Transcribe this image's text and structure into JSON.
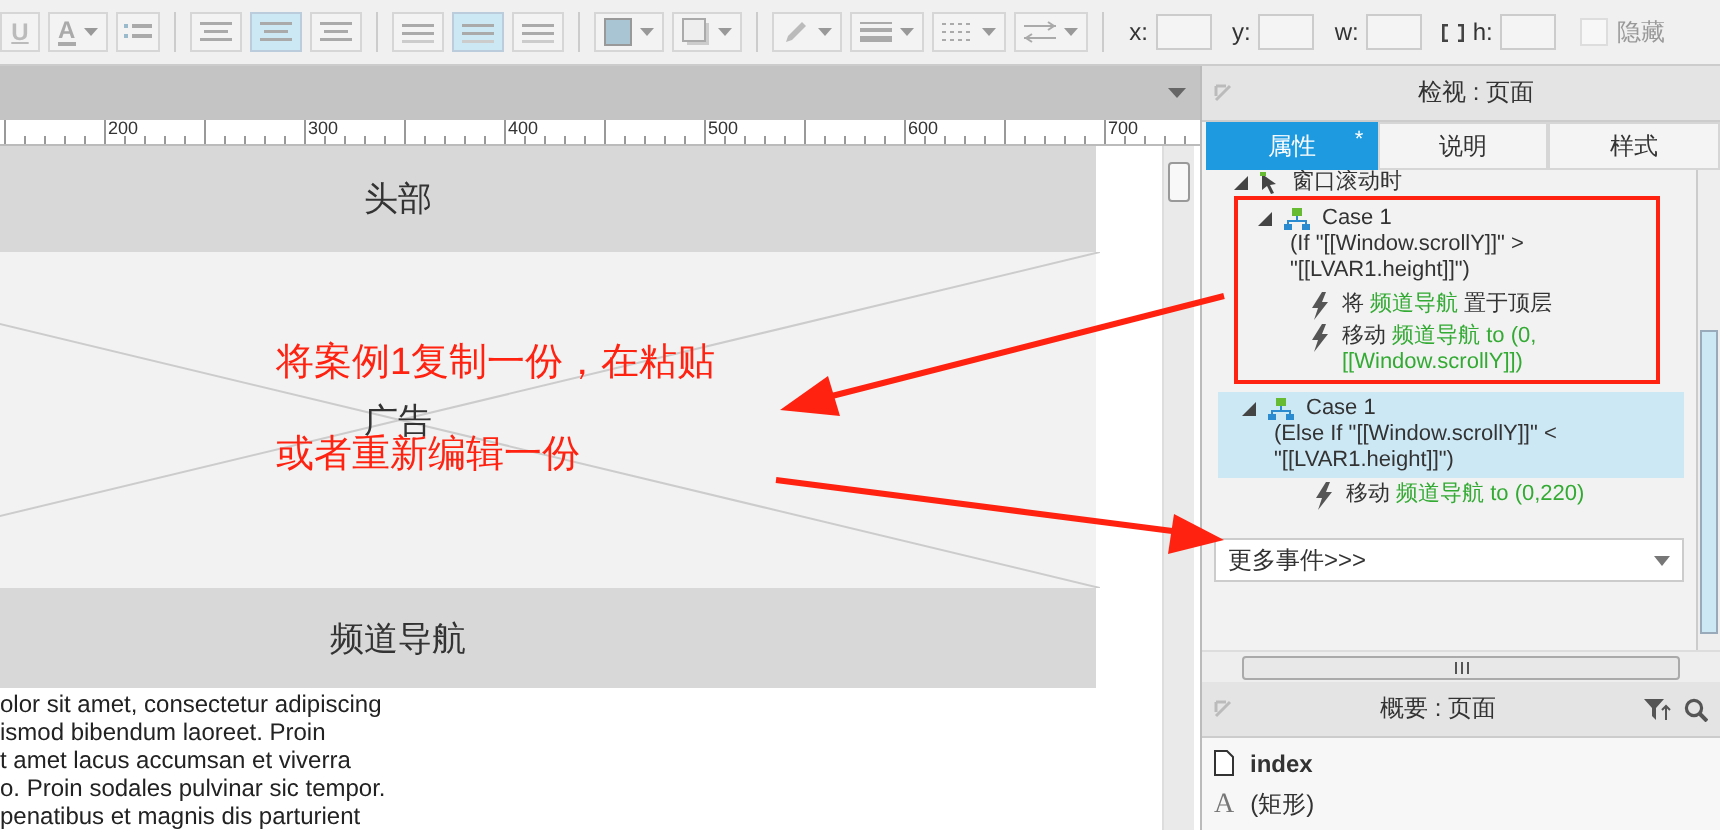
{
  "toolbar": {
    "tools": [
      {
        "kind": "text",
        "label": "U"
      },
      {
        "kind": "font-color",
        "label": "A",
        "dropdown": true
      },
      {
        "kind": "bullets"
      },
      {
        "kind": "separator"
      },
      {
        "kind": "align",
        "selected": false
      },
      {
        "kind": "align",
        "selected": true
      },
      {
        "kind": "align",
        "selected": false
      },
      {
        "kind": "separator"
      },
      {
        "kind": "valign",
        "selected": false
      },
      {
        "kind": "valign",
        "selected": true
      },
      {
        "kind": "valign",
        "selected": false
      },
      {
        "kind": "separator"
      },
      {
        "kind": "fill",
        "dropdown": true
      },
      {
        "kind": "shadow",
        "dropdown": true
      },
      {
        "kind": "separator"
      },
      {
        "kind": "pen",
        "dropdown": true
      },
      {
        "kind": "line-width",
        "dropdown": true
      },
      {
        "kind": "line-style",
        "dropdown": true
      },
      {
        "kind": "arrow-style",
        "dropdown": true
      },
      {
        "kind": "separator"
      }
    ],
    "fields": [
      {
        "label": "x:"
      },
      {
        "label": "y:"
      },
      {
        "label": "w:"
      },
      {
        "label": "h:",
        "lock": true
      }
    ],
    "hidden_checkbox": {
      "label": "隐藏",
      "checked": false
    }
  },
  "canvas": {
    "ruler": [
      "200",
      "300",
      "400",
      "500",
      "600",
      "700"
    ],
    "widgets": [
      {
        "kind": "bar",
        "label": "头部"
      },
      {
        "kind": "placeholder",
        "label": "广告"
      },
      {
        "kind": "bar",
        "label": "频道导航"
      }
    ],
    "paragraph_lines": [
      "olor sit amet, consectetur adipiscing",
      "ismod bibendum laoreet. Proin",
      "t amet lacus accumsan et viverra",
      "o. Proin sodales pulvinar sic tempor.",
      "penatibus et magnis dis parturient"
    ]
  },
  "annotation": {
    "lines": [
      "将案例1复制一份，在粘贴",
      "或者重新编辑一份"
    ]
  },
  "inspector": {
    "title": "检视 : 页面",
    "tabs": [
      {
        "label": "属性",
        "selected": true,
        "badge": "*"
      },
      {
        "label": "说明",
        "selected": false
      },
      {
        "label": "样式",
        "selected": false
      }
    ],
    "event": "窗口滚动时",
    "cases": [
      {
        "title": "Case 1",
        "condition": [
          "(If \"[[Window.scrollY]]\" >",
          "\"[[LVAR1.height]]\")"
        ],
        "selected": false,
        "outlined": true,
        "actions": [
          {
            "verb": "将",
            "target": "频道导航",
            "rest": "置于顶层"
          },
          {
            "verb": "移动",
            "target": "频道导航 to (0, [[Window.scrollY]])"
          }
        ]
      },
      {
        "title": "Case 1",
        "condition": [
          "(Else If \"[[Window.scrollY]]\" <",
          "\"[[LVAR1.height]]\")"
        ],
        "selected": true,
        "outlined": false,
        "actions": [
          {
            "verb": "移动",
            "target": "频道导航 to (0,220)"
          }
        ]
      }
    ],
    "more_events": "更多事件>>>"
  },
  "outline": {
    "title": "概要 : 页面",
    "items": [
      {
        "kind": "page",
        "label": "index"
      },
      {
        "kind": "shape",
        "glyph": "A",
        "label": "(矩形)"
      }
    ]
  }
}
